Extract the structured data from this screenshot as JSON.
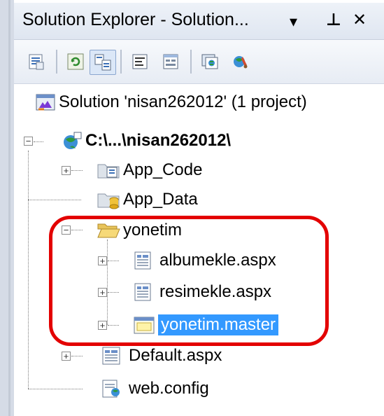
{
  "titlebar": {
    "title": "Solution Explorer - Solution... ",
    "dropdown_glyph": "▾",
    "pin_glyph": "⊥",
    "close_glyph": "✕"
  },
  "toolbar": {
    "buttons": [
      {
        "icon": "properties-icon"
      },
      {
        "icon": "refresh-icon"
      },
      {
        "icon": "nest-related-files-icon",
        "selected": true
      },
      {
        "icon": "view-code-icon"
      },
      {
        "icon": "view-designer-icon"
      },
      {
        "icon": "copy-website-icon"
      },
      {
        "icon": "asp-net-configuration-icon"
      }
    ]
  },
  "tree": {
    "solution": {
      "label": "Solution 'nisan262012' (1 project)",
      "icon": "solution-icon"
    },
    "project": {
      "label": "C:\\...\\nisan262012\\",
      "icon": "web-project-icon",
      "expanded": true
    },
    "items": [
      {
        "label": "App_Code",
        "icon": "app-code-folder-icon",
        "expandable": true
      },
      {
        "label": "App_Data",
        "icon": "app-data-folder-icon",
        "expandable": false
      },
      {
        "label": "yonetim",
        "icon": "open-folder-icon",
        "expandable": true,
        "expanded": true,
        "children": [
          {
            "label": "albumekle.aspx",
            "icon": "aspx-page-icon"
          },
          {
            "label": "resimekle.aspx",
            "icon": "aspx-page-icon"
          },
          {
            "label": "yonetim.master",
            "icon": "master-page-icon",
            "selected": true
          }
        ]
      },
      {
        "label": "Default.aspx",
        "icon": "aspx-page-icon",
        "expandable": true
      },
      {
        "label": "web.config",
        "icon": "config-file-icon",
        "expandable": false
      }
    ]
  },
  "colors": {
    "selection": "#3399ff",
    "annotation_outline": "#e30000",
    "titlebar_bg": "#dfe6f1"
  }
}
